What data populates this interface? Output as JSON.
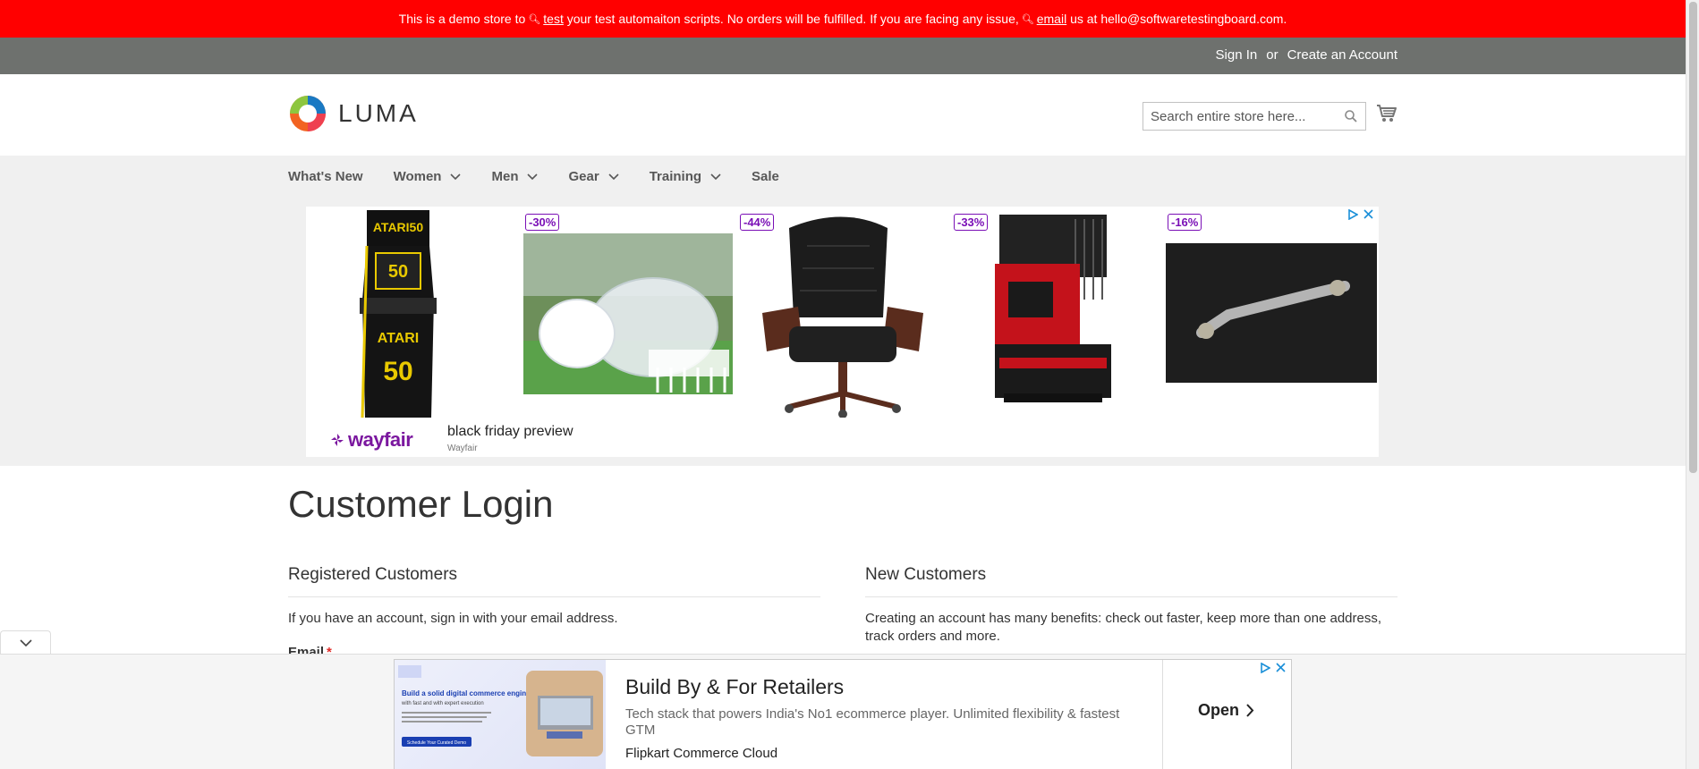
{
  "promo": {
    "text_1": "This is a demo store to",
    "link_test": "test",
    "text_2": "your test automaiton scripts. No orders will be fulfilled. If you are facing any issue,",
    "link_email": "email",
    "text_3": "us at hello@softwaretestingboard.com."
  },
  "panel": {
    "sign_in": "Sign In",
    "or": "or",
    "create_account": "Create an Account"
  },
  "header": {
    "logo_text": "LUMA",
    "search_placeholder": "Search entire store here..."
  },
  "nav": {
    "items": [
      {
        "label": "What's New",
        "has_submenu": false
      },
      {
        "label": "Women",
        "has_submenu": true
      },
      {
        "label": "Men",
        "has_submenu": true
      },
      {
        "label": "Gear",
        "has_submenu": true
      },
      {
        "label": "Training",
        "has_submenu": true
      },
      {
        "label": "Sale",
        "has_submenu": false
      }
    ]
  },
  "ad_top": {
    "discounts": [
      "-30%",
      "-44%",
      "-33%",
      "-16%"
    ],
    "brand_logo": "wayfair",
    "headline": "black friday preview",
    "brand": "Wayfair"
  },
  "main": {
    "page_title": "Customer Login",
    "registered": {
      "title": "Registered Customers",
      "text": "If you have an account, sign in with your email address.",
      "email_label": "Email",
      "required_mark": "*"
    },
    "new_customers": {
      "title": "New Customers",
      "text_line_1": "Creating an account has many benefits: check out faster, keep more than one address,",
      "text_line_2": "track orders and more."
    }
  },
  "ad_bottom": {
    "title": "Build By & For Retailers",
    "description": "Tech stack that powers India's No1 ecommerce player. Unlimited flexibility & fastest GTM",
    "brand": "Flipkart Commerce Cloud",
    "cta": "Open",
    "thumb_headline": "Build a solid digital commerce engine",
    "thumb_sub": "with fast and with expert execution",
    "thumb_button": "Schedule Your Curated Demo"
  },
  "colors": {
    "promo_bg": "#ff0000",
    "panel_bg": "#6e716e",
    "nav_bg": "#f0f0f0",
    "discount_badge": "#7a0fb6",
    "required": "#e02b27"
  }
}
